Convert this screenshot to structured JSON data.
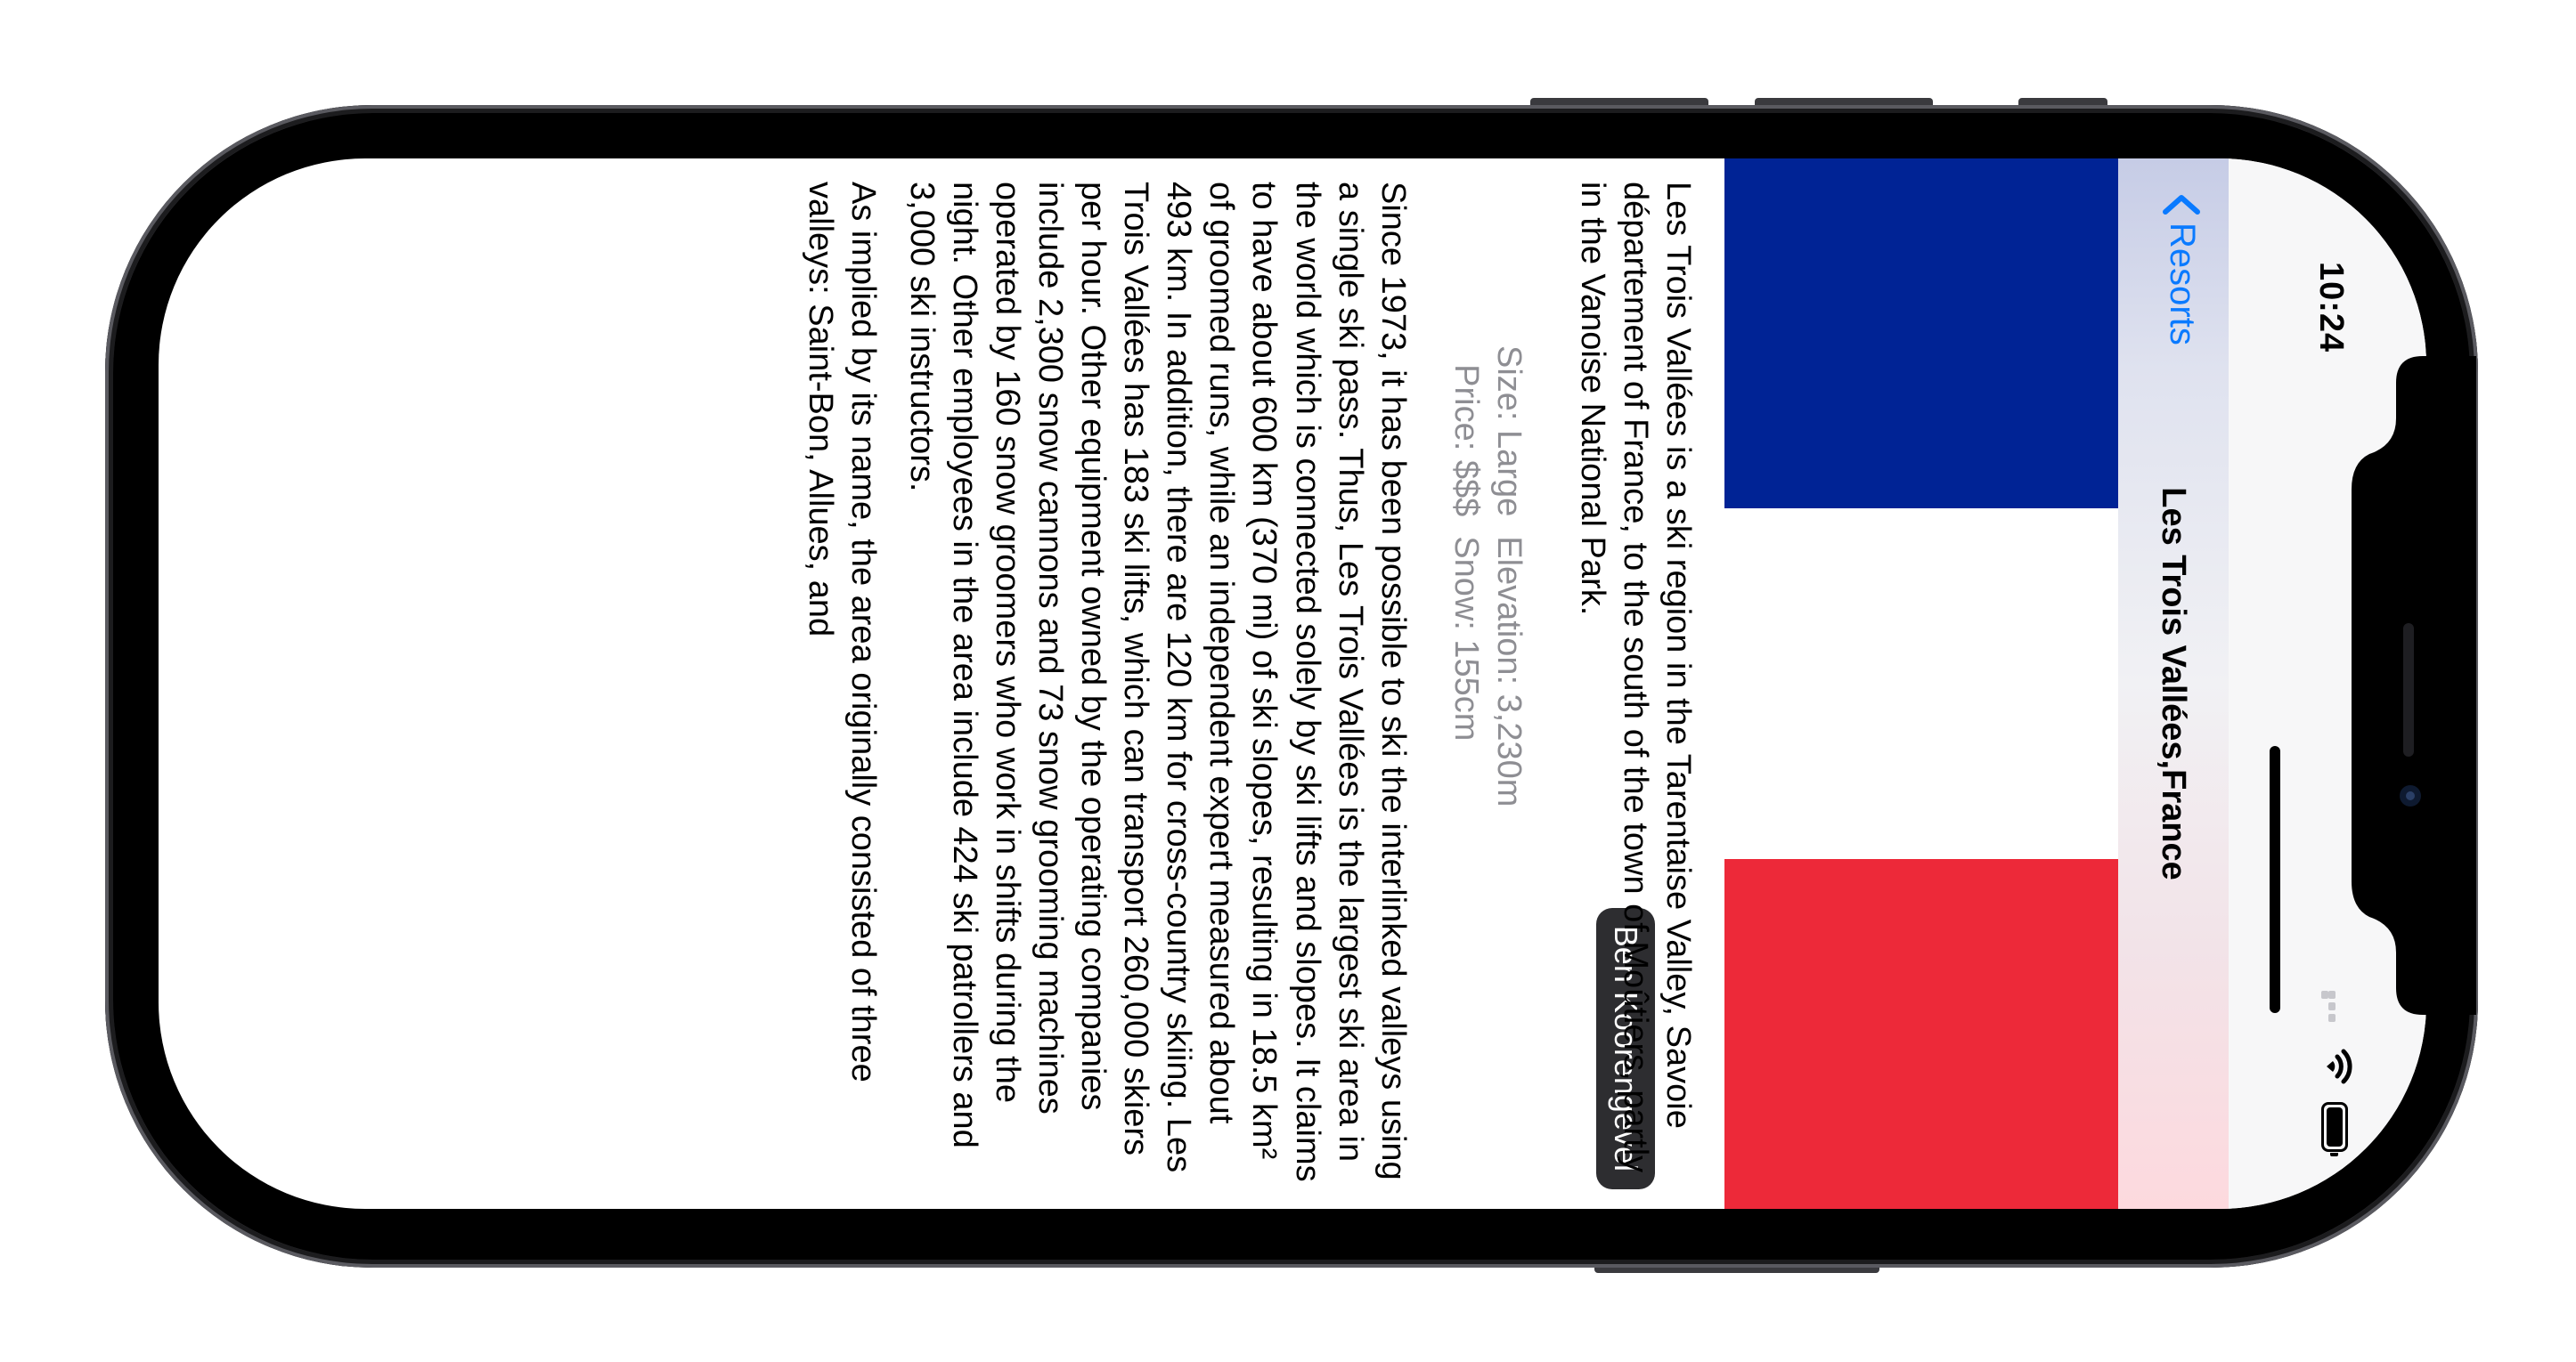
{
  "status_bar": {
    "time": "10:24",
    "battery_percent": 100
  },
  "nav": {
    "back_label": "Resorts",
    "title": "Les Trois Vallées,France"
  },
  "hero": {
    "flag_colors": [
      "#002395",
      "#ffffff",
      "#ed2939"
    ],
    "photo_credit": "Ben Koorengevel"
  },
  "resort": {
    "intro": "Les Trois Vallées is a ski region in the Tarentaise Valley, Savoie département of France, to the south of the town of Moûtiers, partly in the Vanoise National Park.",
    "size": "Size: Large",
    "price": "Price: $$$",
    "elevation": "Elevation: 3,230m",
    "snow": "Snow: 155cm",
    "paragraphs": [
      "Since 1973, it has been possible to ski the interlinked valleys using a single ski pass. Thus, Les Trois Vallées is the largest ski area in the world which is connected solely by ski lifts and slopes. It claims to have about 600 km (370 mi) of ski slopes, resulting in 18.5 km² of groomed runs, while an independent expert measured about 493 km. In addition, there are 120 km for cross-country skiing. Les Trois Vallées has 183 ski lifts, which can transport 260,000 skiers per hour. Other equipment owned by the operating companies include 2,300 snow cannons and 73 snow grooming machines operated by 160 snow groomers who work in shifts during the night. Other employees in the area include 424 ski patrollers and 3,000 ski instructors.",
      "As implied by its name, the area originally consisted of three valleys: Saint-Bon, Allues, and"
    ]
  }
}
